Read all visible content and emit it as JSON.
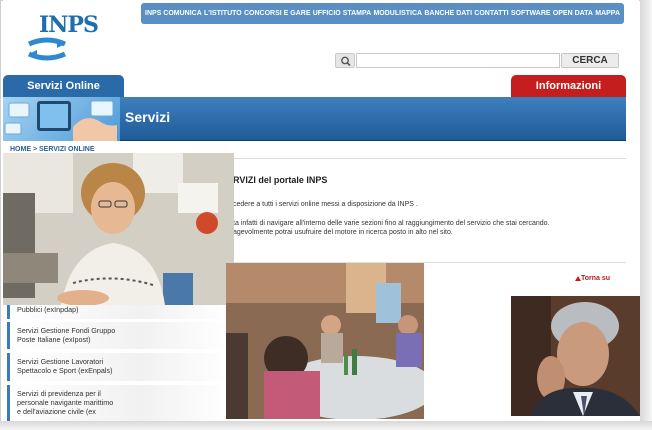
{
  "logo": {
    "text": "INPS"
  },
  "topnav": {
    "items": [
      "INPS COMUNICA",
      "L'ISTITUTO",
      "CONCORSI E GARE",
      "UFFICIO STAMPA",
      "MODULISTICA",
      "BANCHE DATI",
      "CONTATTI",
      "SOFTWARE",
      "OPEN DATA",
      "MAPPA"
    ]
  },
  "search": {
    "value": "",
    "button_label": "CERCA",
    "icon": "search-icon"
  },
  "tabs": {
    "left": "Servizi Online",
    "right": "Informazioni"
  },
  "banner": {
    "title": "Servizi"
  },
  "breadcrumb": {
    "home": "HOME",
    "separator": ">",
    "current": "SERVIZI ONLINE"
  },
  "content": {
    "heading": "RVIZI del portale INPS",
    "p1": "cedere a tutti i servizi online messi a disposizione da INPS .",
    "p2": "ta infatti di navigare all'interno delle varie sezioni fino al raggiungimento del servizio che stai cercando.",
    "p3": "agevolmente potrai usufruire del motore in ricerca posto in alto nel sito.",
    "torna_su": "Torna su"
  },
  "services": [
    {
      "lines": [
        "Pubblici (exInpdap)"
      ]
    },
    {
      "lines": [
        "Servizi Gestione Fondi Gruppo",
        "Poste Italiane (exIpost)"
      ]
    },
    {
      "lines": [
        "Servizi Gestione Lavoratori",
        "Spettacolo e Sport (exEnpals)"
      ]
    },
    {
      "lines": [
        "Servizi di previdenza per il",
        "personale navigante marittimo",
        "e dell'aviazione civile (ex"
      ]
    }
  ],
  "colors": {
    "brand_blue": "#2a6aa8",
    "nav_blue": "#5a8fc4",
    "accent_red": "#c41e1e"
  }
}
